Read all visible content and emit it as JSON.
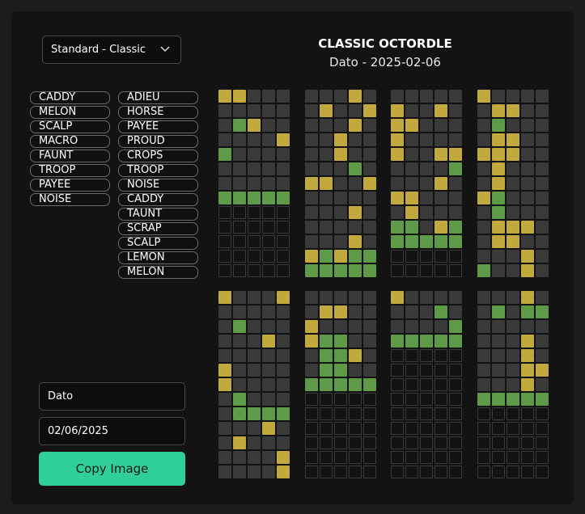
{
  "mode": {
    "selected": "Standard - Classic"
  },
  "header": {
    "title": "CLASSIC OCTORDLE",
    "subtitle": "Dato - 2025-02-06"
  },
  "guesses_left": [
    "CADDY",
    "MELON",
    "SCALP",
    "MACRO",
    "FAUNT",
    "TROOP",
    "PAYEE",
    "NOISE"
  ],
  "guesses_right": [
    "ADIEU",
    "HORSE",
    "PAYEE",
    "PROUD",
    "CROPS",
    "TROOP",
    "NOISE",
    "CADDY",
    "TAUNT",
    "SCRAP",
    "SCALP",
    "LEMON",
    "MELON"
  ],
  "fields": {
    "label_value": "Dato",
    "date_value": "02/06/2025"
  },
  "buttons": {
    "copy_label": "Copy Image"
  },
  "colors": {
    "green": "#5f9a49",
    "yellow": "#c1a93e",
    "gray": "#3a3a3a",
    "accent": "#2fcf97"
  },
  "boards": [
    [
      "YYxxx",
      "xxxxx",
      "xGYxx",
      "xxxxY",
      "Gxxxx",
      "xxxxx",
      "xxxxx",
      "GGGGG",
      "eeeee",
      "eeeee",
      "eeeee",
      "eeeee",
      "eeeee"
    ],
    [
      "xxxYx",
      "xYxxY",
      "xxxYx",
      "xxYxx",
      "xxYxx",
      "xxxGx",
      "YYxxY",
      "xxxxx",
      "xxxYx",
      "xxxxx",
      "xxxYx",
      "YGYGG",
      "GGGGG"
    ],
    [
      "xxxxx",
      "YxxYx",
      "YYxxx",
      "Yxxxx",
      "YxxYY",
      "xxxxG",
      "xxxYx",
      "YYxxx",
      "xYxxx",
      "GGxYG",
      "GGGGG",
      "eeeee",
      "eeeee"
    ],
    [
      "Yxxxx",
      "xYYxx",
      "xGxxx",
      "xYYxx",
      "YYYxx",
      "xYxxx",
      "xYxxx",
      "YGxxx",
      "xGxxx",
      "xYYYx",
      "xYYxx",
      "xxxYx",
      "GxxYx"
    ],
    [
      "YxxxY",
      "xxxxx",
      "xGxxx",
      "xxxYx",
      "xxxxx",
      "Yxxxx",
      "Yxxxx",
      "xGxxx",
      "xGGGG",
      "xxxYx",
      "xYxxx",
      "xxxxY",
      "xxxxY"
    ],
    [
      "xxxxx",
      "xYYxx",
      "Yxxxx",
      "YGGxx",
      "xGGYx",
      "xGGxx",
      "GGGGG",
      "eeeee",
      "eeeee",
      "eeeee",
      "eeeee",
      "eeeee",
      "eeeee"
    ],
    [
      "Yxxxx",
      "xxxGx",
      "xxxxG",
      "GGGGG",
      "eeeee",
      "eeeee",
      "eeeee",
      "eeeee",
      "eeeee",
      "eeeee",
      "eeeee",
      "eeeee",
      "eeeee"
    ],
    [
      "xxxYx",
      "xGxGG",
      "xxxxx",
      "xxxYx",
      "xxxYx",
      "xxxYY",
      "xxxYx",
      "GGGGG",
      "eeeee",
      "eeeee",
      "eeeee",
      "eeeee",
      "eeeee"
    ]
  ]
}
